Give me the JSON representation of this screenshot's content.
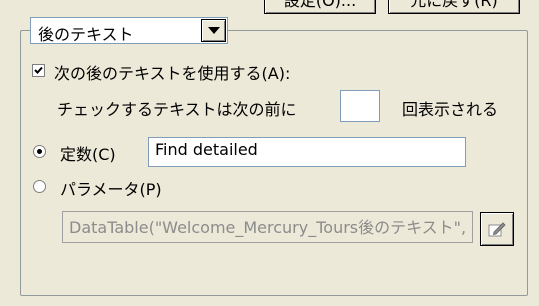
{
  "buttons": {
    "settings": "設定(O)...",
    "restore": "元に戻す(R)"
  },
  "dropdown": {
    "selected": "後のテキスト"
  },
  "use_following": {
    "label": "次の後のテキストを使用する(A):",
    "checked": true
  },
  "check_text": {
    "prefix": "チェックするテキストは次の前に",
    "suffix": "回表示される",
    "count": ""
  },
  "constant": {
    "label": "定数(C)",
    "selected": true,
    "value": "Find detailed"
  },
  "parameter": {
    "label": "パラメータ(P)",
    "selected": false,
    "value": "DataTable(\"Welcome_Mercury_Tours後のテキスト\","
  },
  "icons": {
    "edit": "edit-pencil-icon"
  }
}
